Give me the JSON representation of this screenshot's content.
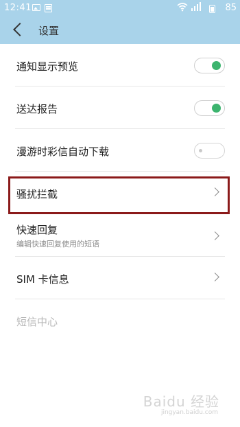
{
  "status_bar": {
    "time": "12:41",
    "battery_text": "85",
    "icons": [
      "image-icon",
      "document-icon",
      "wifi-icon",
      "signal-icon",
      "battery-icon"
    ]
  },
  "app_bar": {
    "title": "设置",
    "back_icon": "chevron-left-icon"
  },
  "settings": [
    {
      "label": "通知显示预览",
      "type": "toggle",
      "state": "on"
    },
    {
      "label": "送达报告",
      "type": "toggle",
      "state": "on"
    },
    {
      "label": "漫游时彩信自动下载",
      "type": "toggle",
      "state": "off"
    },
    {
      "label": "骚扰拦截",
      "type": "link",
      "highlighted": true
    },
    {
      "label": "快速回复",
      "subtitle": "编辑快速回复使用的短语",
      "type": "link"
    },
    {
      "label": "SIM 卡信息",
      "type": "link"
    },
    {
      "label": "短信中心",
      "type": "disabled"
    }
  ],
  "colors": {
    "header_bg": "#a9d3ea",
    "toggle_on": "#3cb46e",
    "highlight_border": "#8b1a1a"
  },
  "watermark": {
    "text": "Baidu 经验",
    "sub": "jingyan.baidu.com"
  }
}
